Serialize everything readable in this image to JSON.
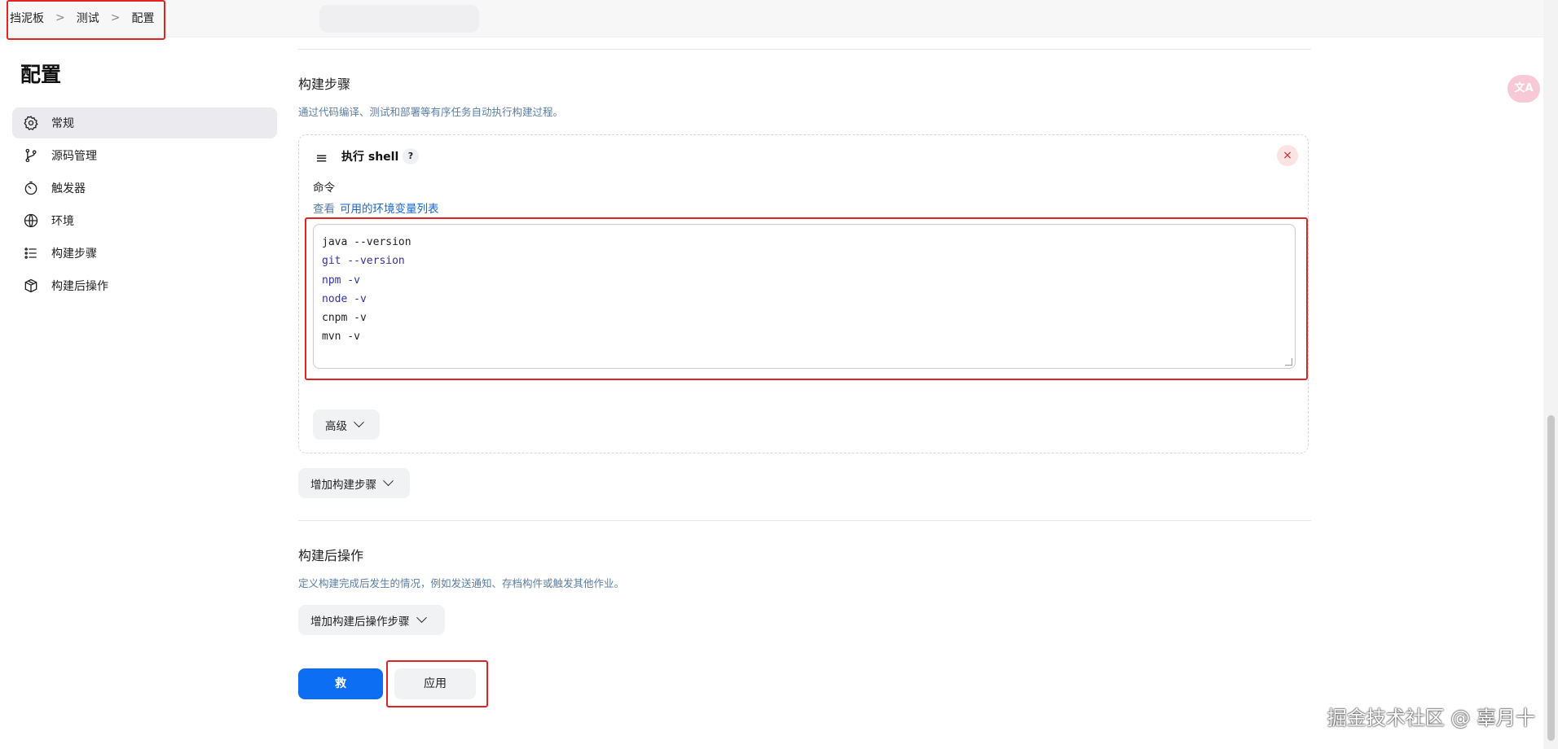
{
  "breadcrumb": {
    "items": [
      "挡泥板",
      "测试",
      "配置"
    ],
    "separator": ">"
  },
  "sidebar": {
    "title": "配置",
    "items": [
      {
        "label": "常规",
        "icon": "gear-icon",
        "active": true
      },
      {
        "label": "源码管理",
        "icon": "branch-icon",
        "active": false
      },
      {
        "label": "触发器",
        "icon": "timer-icon",
        "active": false
      },
      {
        "label": "环境",
        "icon": "globe-icon",
        "active": false
      },
      {
        "label": "构建步骤",
        "icon": "list-icon",
        "active": false
      },
      {
        "label": "构建后操作",
        "icon": "package-icon",
        "active": false
      }
    ]
  },
  "build_steps": {
    "title": "构建步骤",
    "description": "通过代码编译、测试和部署等有序任务自动执行构建过程。",
    "step": {
      "name": "执行 shell",
      "help": "?",
      "close": "×",
      "command_label": "命令",
      "env_prefix": "查看",
      "env_link": "可用的环境变量列表",
      "command_lines": [
        "java --version",
        "git --version",
        "npm -v",
        "node -v",
        "cnpm -v",
        "mvn -v"
      ],
      "advanced_label": "高级"
    },
    "add_step_label": "增加构建步骤"
  },
  "post_build": {
    "title": "构建后操作",
    "description": "定义构建完成后发生的情况，例如发送通知、存档构件或触发其他作业。",
    "add_label": "增加构建后操作步骤"
  },
  "actions": {
    "save_label": "救",
    "apply_label": "应用"
  },
  "floating": {
    "translate_glyph": "文A"
  },
  "watermark": "掘金技术社区 @ 辜月十",
  "colors": {
    "primary": "#0b6ef3",
    "highlight_border": "#e02424",
    "link": "#1a66c9",
    "muted_text": "#5a7ea6"
  }
}
